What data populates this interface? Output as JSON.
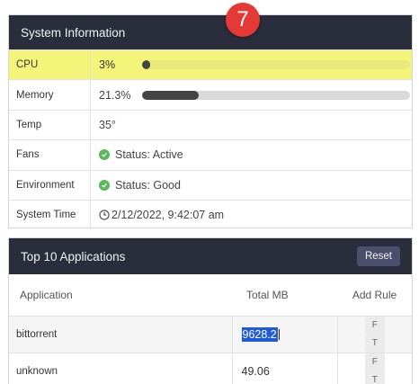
{
  "system_info": {
    "title": "System Information",
    "rows": {
      "cpu": {
        "label": "CPU",
        "value": "3%",
        "progress": 0.03
      },
      "memory": {
        "label": "Memory",
        "value": "21.3%",
        "progress": 0.213
      },
      "temp": {
        "label": "Temp",
        "value": "35°"
      },
      "fans": {
        "label": "Fans",
        "value": "Status: Active"
      },
      "environment": {
        "label": "Environment",
        "value": "Status: Good"
      },
      "system_time": {
        "label": "System Time",
        "value": "2/12/2022, 9:42:07 am"
      }
    }
  },
  "step_badge": "7",
  "apps": {
    "title": "Top 10 Applications",
    "reset_label": "Reset",
    "columns": {
      "application": "Application",
      "total_mb": "Total MB",
      "add_rule": "Add Rule"
    },
    "rows": [
      {
        "name": "bittorrent",
        "total_mb": "9628.2",
        "rule_f": "F",
        "rule_t": "T"
      },
      {
        "name": "unknown",
        "total_mb": "49.06",
        "rule_f": "F",
        "rule_t": "T"
      }
    ]
  },
  "colors": {
    "header_bg": "#2a2d3b",
    "highlight": "#f4f37a",
    "badge": "#e53935",
    "status_ok": "#5cb85c",
    "selection": "#1f5bd6"
  }
}
